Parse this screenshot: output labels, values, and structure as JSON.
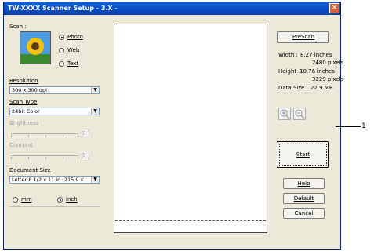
{
  "window": {
    "title": "TW-XXXX Scanner Setup - 3.X -",
    "close_glyph": "×"
  },
  "scan": {
    "label": "Scan :",
    "options": [
      {
        "label": "Photo",
        "selected": true
      },
      {
        "label": "Web",
        "selected": false
      },
      {
        "label": "Text",
        "selected": false
      }
    ]
  },
  "resolution": {
    "label": "Resolution",
    "value": "300 x 300 dpi"
  },
  "scan_type": {
    "label": "Scan Type",
    "value": "24bit Color"
  },
  "brightness": {
    "label": "Brightness",
    "value": "0"
  },
  "contrast": {
    "label": "Contrast",
    "value": "0"
  },
  "document_size": {
    "label": "Document Size",
    "value": "Letter 8 1/2 x 11 in (215.9 x"
  },
  "units": {
    "options": [
      {
        "label": "mm",
        "selected": false
      },
      {
        "label": "inch",
        "selected": true
      }
    ]
  },
  "info": {
    "width_label": "Width :",
    "width_inches": "8.27 inches",
    "width_pixels": "2480 pixels",
    "height_label": "Height :",
    "height_inches": "10.76 inches",
    "height_pixels": "3229 pixels",
    "data_size_label": "Data Size :",
    "data_size_value": "22.9 MB"
  },
  "buttons": {
    "prescan": "PreScan",
    "start": "Start",
    "help": "Help",
    "default": "Default",
    "cancel": "Cancel"
  },
  "callout": {
    "number": "1"
  },
  "icons": {
    "zoom_in": "zoom-in-icon",
    "zoom_out": "zoom-out-icon",
    "dropdown": "chevron-down-icon"
  }
}
